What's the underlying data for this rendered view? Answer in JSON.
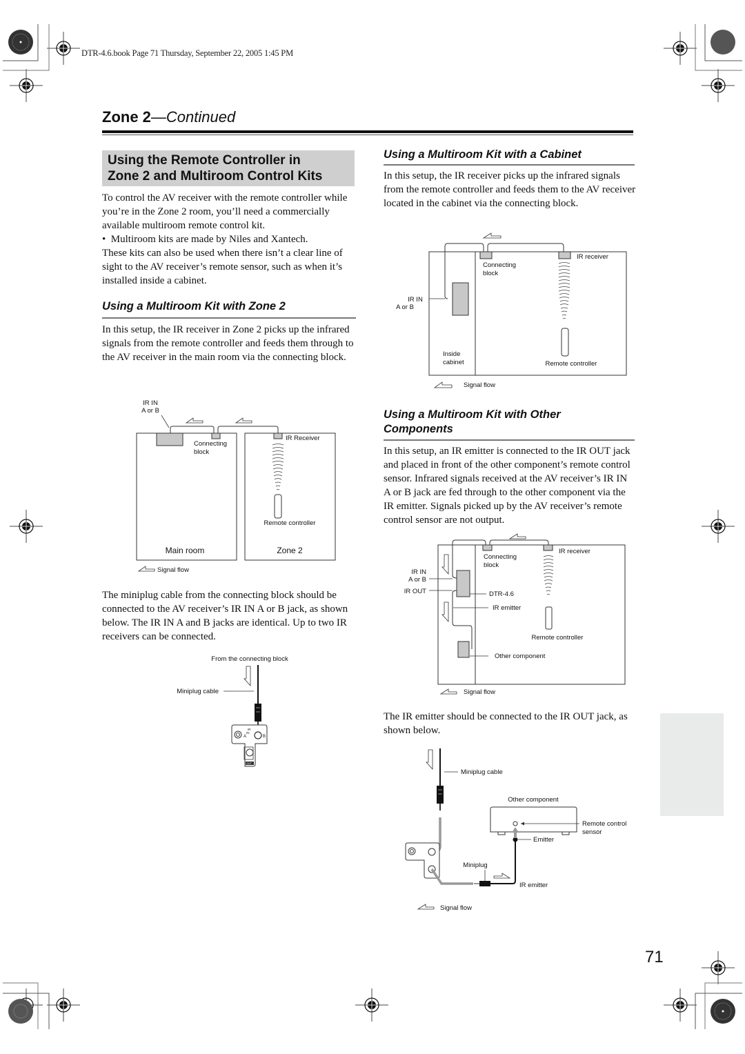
{
  "file_header": "DTR-4.6.book  Page 71  Thursday, September 22, 2005  1:45 PM",
  "section": {
    "title": "Zone 2",
    "continued": "—Continued"
  },
  "main_heading": [
    "Using the Remote Controller in",
    "Zone 2 and Multiroom Control Kits"
  ],
  "intro": {
    "para1": "To control the AV receiver with the remote controller while you’re in the Zone 2 room, you’ll need a commercially available multiroom remote control kit.",
    "bullet": "Multiroom kits are made by Niles and Xantech.",
    "para2": "These kits can also be used when there isn’t a clear line of sight to the AV receiver’s remote sensor, such as when it’s installed inside a cabinet."
  },
  "zone2_kit": {
    "heading": "Using a Multiroom Kit with Zone 2",
    "text": "In this setup, the IR receiver in Zone 2 picks up the infrared signals from the remote controller and feeds them through to the AV receiver in the main room via the connecting block.",
    "diagram": {
      "ir_in_1": "IR IN",
      "ir_in_2": "A or B",
      "connecting_1": "Connecting",
      "connecting_2": "block",
      "ir_receiver": "IR Receiver",
      "remote": "Remote controller",
      "main_room": "Main room",
      "zone2": "Zone 2",
      "signal_flow": "Signal flow"
    },
    "after_text": "The miniplug cable from the connecting block should be connected to the AV receiver’s IR IN A or B jack, as shown below. The IR IN A and B jacks are identical. Up to two IR receivers can be connected.",
    "jack_diagram": {
      "from": "From the connecting block",
      "cable": "Miniplug cable",
      "ir": "IR",
      "in": "IN",
      "a": "A",
      "b": "B",
      "out": "OUT"
    }
  },
  "cabinet_kit": {
    "heading": "Using a Multiroom Kit with a Cabinet",
    "text": "In this setup, the IR receiver picks up the infrared signals from the remote controller and feeds them to the AV receiver located in the cabinet via the connecting block.",
    "diagram": {
      "connecting_1": "Connecting",
      "connecting_2": "block",
      "ir_receiver": "IR receiver",
      "ir_in_1": "IR IN",
      "ir_in_2": "A or B",
      "inside_1": "Inside",
      "inside_2": "cabinet",
      "remote": "Remote controller",
      "signal_flow": "Signal flow"
    }
  },
  "other_kit": {
    "heading": [
      "Using a Multiroom Kit with Other",
      "Components"
    ],
    "text": "In this setup, an IR emitter is connected to the IR OUT jack and placed in front of the other component’s remote control sensor. Infrared signals received at the AV receiver’s IR IN A or B jack are fed through to the other component via the IR emitter. Signals picked up by the AV receiver’s remote control sensor are not output.",
    "diagram": {
      "connecting_1": "Connecting",
      "connecting_2": "block",
      "ir_receiver": "IR receiver",
      "ir_in_1": "IR IN",
      "ir_in_2": "A or B",
      "ir_out": "IR OUT",
      "model": "DTR-4.6",
      "ir_emitter": "IR emitter",
      "remote": "Remote controller",
      "other": "Other component",
      "signal_flow": "Signal flow"
    },
    "after_text": "The IR emitter should be connected to the IR OUT jack, as shown below.",
    "emitter_diagram": {
      "cable": "Miniplug cable",
      "other": "Other component",
      "sensor_1": "Remote control",
      "sensor_2": "sensor",
      "emitter": "Emitter",
      "miniplug": "Miniplug",
      "ir_emitter": "IR emitter",
      "signal_flow": "Signal flow"
    }
  },
  "page_number": "71"
}
